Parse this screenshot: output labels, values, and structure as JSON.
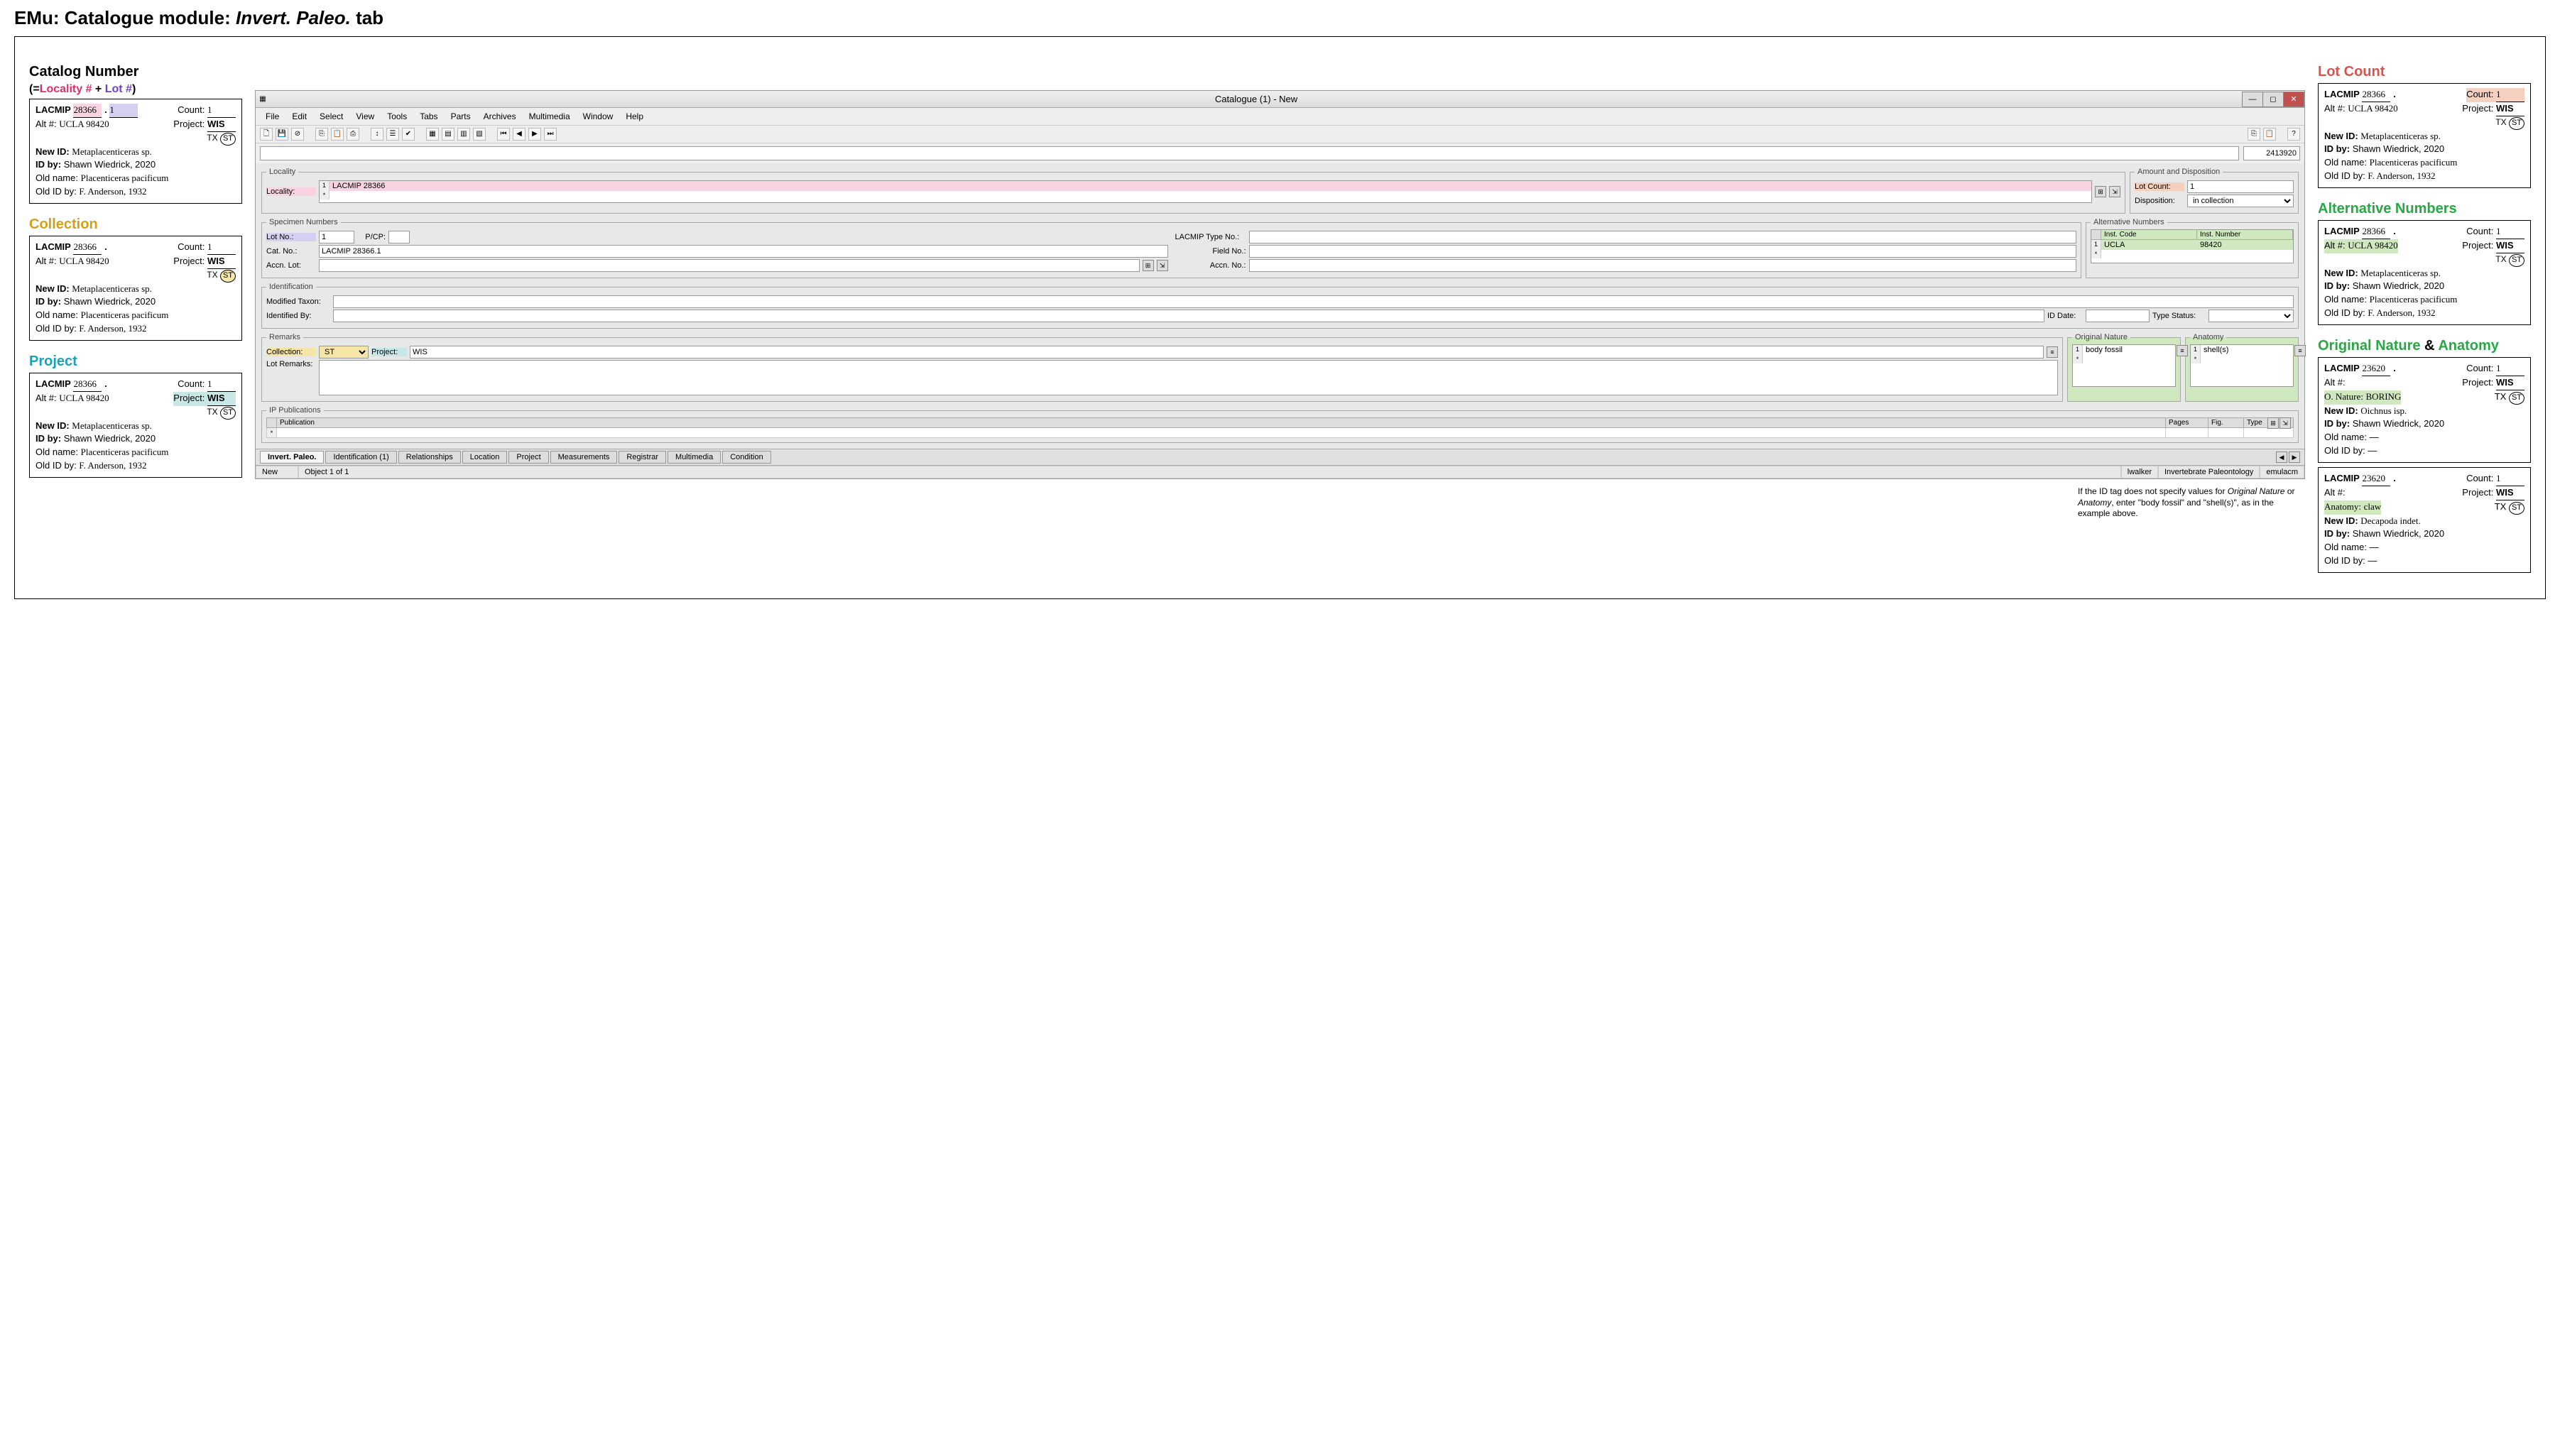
{
  "page_title_prefix": "EMu: Catalogue module: ",
  "page_title_tab": "Invert. Paleo.",
  "page_title_suffix": " tab",
  "left": {
    "catalog_heading": "Catalog Number",
    "catalog_sub_open": "(=",
    "catalog_sub_loc": "Locality #",
    "catalog_sub_plus": " + ",
    "catalog_sub_lot": "Lot #",
    "catalog_sub_close": ")",
    "collection_heading": "Collection",
    "project_heading": "Project"
  },
  "right": {
    "lotcount_heading": "Lot Count",
    "altnum_heading": "Alternative Numbers",
    "nature_heading_1": "Original Nature",
    "nature_heading_amp": " & ",
    "nature_heading_2": "Anatomy"
  },
  "card_common": {
    "lacmip_label": "LACMIP",
    "lacmip_num": "28366",
    "dot": ".",
    "lot_num": "1",
    "count_label": "Count:",
    "count_val": "1",
    "alt_label": "Alt #:",
    "alt_val": "UCLA 98420",
    "project_label": "Project:",
    "project_val": "WIS",
    "tx": "TX",
    "st": "ST",
    "newid_label": "New ID:",
    "newid_val": "Metaplacenticeras sp.",
    "idby_label": "ID by:",
    "idby_val": "Shawn Wiedrick, 2020",
    "oldname_label": "Old name:",
    "oldname_val": "Placenticeras pacificum",
    "oldidby_label": "Old ID by:",
    "oldidby_val": "F. Anderson, 1932"
  },
  "card_nature": {
    "lacmip_num": "23620",
    "alt_val": "",
    "nature_label": "O. Nature:",
    "nature_val": "BORING",
    "newid_val": "Oichnus isp.",
    "oldname_val": "—",
    "oldidby_val": "—"
  },
  "card_anatomy": {
    "lacmip_num": "23620",
    "anat_label": "Anatomy:",
    "anat_val": "claw",
    "newid_val": "Decapoda indet.",
    "oldname_val": "—",
    "oldidby_val": "—"
  },
  "emu": {
    "title": "Catalogue (1) - New",
    "menus": [
      "File",
      "Edit",
      "Select",
      "View",
      "Tools",
      "Tabs",
      "Parts",
      "Archives",
      "Multimedia",
      "Window",
      "Help"
    ],
    "irn": "2413920",
    "locality": {
      "legend": "Locality",
      "label": "Locality:",
      "rownum": "1",
      "value": "LACMIP 28366"
    },
    "amount": {
      "legend": "Amount and Disposition",
      "lotcount_label": "Lot Count:",
      "lotcount_value": "1",
      "disposition_label": "Disposition:",
      "disposition_value": "in collection"
    },
    "specimen": {
      "legend": "Specimen Numbers",
      "lotno_label": "Lot No.:",
      "lotno_value": "1",
      "pcp_label": "P/CP:",
      "catno_label": "Cat. No.:",
      "catno_value": "LACMIP 28366.1",
      "accnlot_label": "Accn. Lot:",
      "typeno_label": "LACMIP Type No.:",
      "fieldno_label": "Field No.:",
      "accnno_label": "Accn. No.:"
    },
    "altnum": {
      "legend": "Alternative Numbers",
      "col1": "Inst. Code",
      "col2": "Inst. Number",
      "rownum": "1",
      "val1": "UCLA",
      "val2": "98420"
    },
    "ident": {
      "legend": "Identification",
      "modtaxon_label": "Modified Taxon:",
      "idby_label": "Identified By:",
      "iddate_label": "ID Date:",
      "typestatus_label": "Type Status:"
    },
    "remarks": {
      "legend": "Remarks",
      "collection_label": "Collection:",
      "collection_value": "ST",
      "project_label": "Project:",
      "project_value": "WIS",
      "lotremarks_label": "Lot Remarks:"
    },
    "nature": {
      "legend": "Original Nature",
      "rownum": "1",
      "value": "body fossil"
    },
    "anatomy": {
      "legend": "Anatomy",
      "rownum": "1",
      "value": "shell(s)"
    },
    "pub": {
      "legend": "IP Publications",
      "col1": "Publication",
      "col2": "Pages",
      "col3": "Fig.",
      "col4": "Type"
    },
    "tabs": [
      "Invert. Paleo.",
      "Identification (1)",
      "Relationships",
      "Location",
      "Project",
      "Measurements",
      "Registrar",
      "Multimedia",
      "Condition"
    ],
    "status": {
      "mode": "New",
      "pos": "Object 1 of 1",
      "user": "lwalker",
      "dept": "Invertebrate Paleontology",
      "host": "emulacm"
    }
  },
  "footnote_1": "If the ID tag does not specify values for ",
  "footnote_i1": "Original Nature",
  "footnote_2": " or ",
  "footnote_i2": "Anatomy",
  "footnote_3": ", enter \"body fossil\" and \"shell(s)\", as in the example above."
}
